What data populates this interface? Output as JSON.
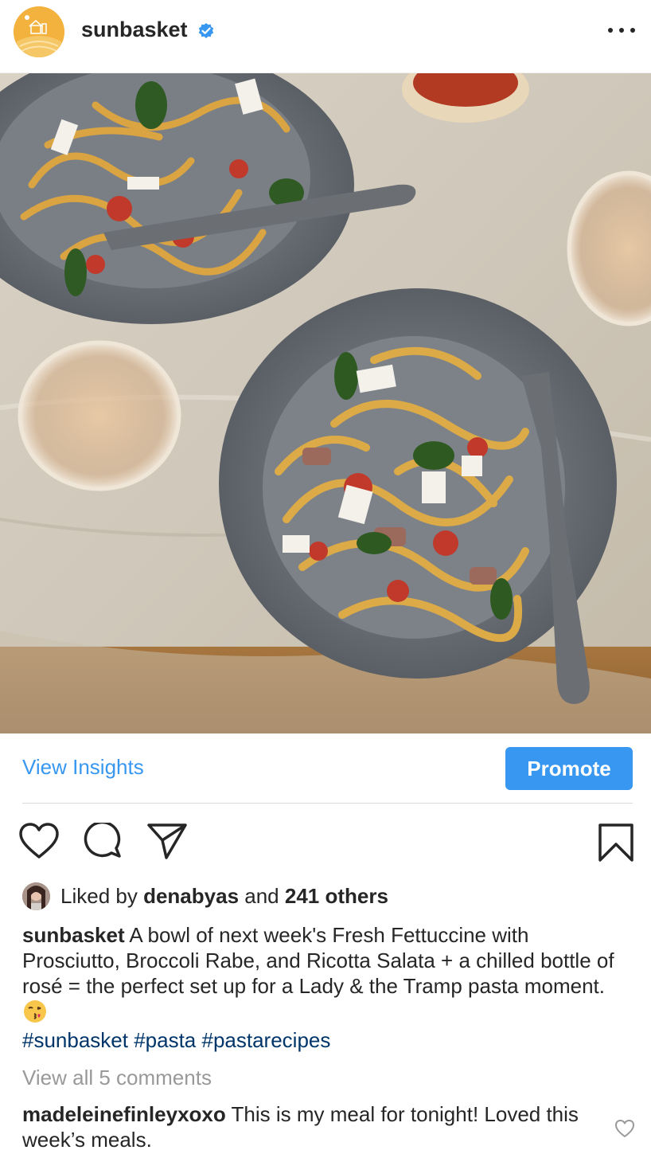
{
  "post": {
    "username": "sunbasket",
    "verified_icon": "verified-badge-icon",
    "more_icon": "more-options-icon"
  },
  "insights": {
    "view_label": "View Insights",
    "promote_label": "Promote"
  },
  "actions": {
    "like_icon": "heart-icon",
    "comment_icon": "comment-icon",
    "share_icon": "send-icon",
    "save_icon": "bookmark-icon"
  },
  "likes": {
    "prefix": "Liked by ",
    "user": "denabyas",
    "middle": " and ",
    "others": "241 others"
  },
  "caption": {
    "username": "sunbasket",
    "text": " A bowl of next week's Fresh Fettuccine with Prosciutto, Broccoli Rabe, and Ricotta Salata + a chilled bottle of rosé = the perfect set up for a Lady & the Tramp pasta moment. ",
    "hashtags": "#sunbasket #pasta #pastarecipes"
  },
  "comments": {
    "view_all": "View all 5 comments",
    "items": [
      {
        "username": "madeleinefinleyxoxo",
        "text": " This is my meal for tonight! Loved this week’s meals."
      }
    ]
  },
  "colors": {
    "link_blue": "#3897f0",
    "hashtag_blue": "#003569",
    "brand_orange": "#f2b23d"
  }
}
